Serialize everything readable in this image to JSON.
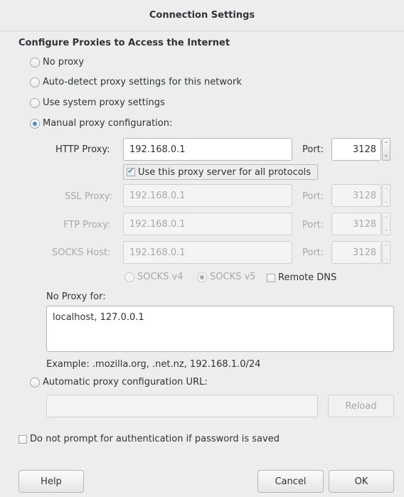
{
  "window": {
    "title": "Connection Settings"
  },
  "section_heading": "Configure Proxies to Access the Internet",
  "proxy_modes": [
    {
      "label": "No proxy",
      "selected": false
    },
    {
      "label": "Auto-detect proxy settings for this network",
      "selected": false
    },
    {
      "label": "Use system proxy settings",
      "selected": false
    },
    {
      "label": "Manual proxy configuration:",
      "selected": true
    }
  ],
  "http": {
    "label": "HTTP Proxy:",
    "value": "192.168.0.1",
    "port_label": "Port:",
    "port": "3128"
  },
  "share_all": {
    "label": "Use this proxy server for all protocols",
    "checked": true
  },
  "ssl": {
    "label": "SSL Proxy:",
    "value": "192.168.0.1",
    "port_label": "Port:",
    "port": "3128"
  },
  "ftp": {
    "label": "FTP Proxy:",
    "value": "192.168.0.1",
    "port_label": "Port:",
    "port": "3128"
  },
  "socks": {
    "label": "SOCKS Host:",
    "value": "192.168.0.1",
    "port_label": "Port:",
    "port": "3128"
  },
  "socks_versions": [
    {
      "label": "SOCKS v4",
      "selected": false
    },
    {
      "label": "SOCKS v5",
      "selected": true
    }
  ],
  "remote_dns": {
    "label": "Remote DNS",
    "checked": false
  },
  "no_proxy": {
    "label": "No Proxy for:",
    "value": "localhost, 127.0.0.1",
    "example": "Example: .mozilla.org, .net.nz, 192.168.1.0/24"
  },
  "auto_config": {
    "label": "Automatic proxy configuration URL:",
    "selected": false,
    "value": "",
    "reload_label": "Reload"
  },
  "auth_prompt": {
    "label": "Do not prompt for authentication if password is saved",
    "checked": false
  },
  "buttons": {
    "help": "Help",
    "cancel": "Cancel",
    "ok": "OK"
  },
  "colors": {
    "accent": "#4a90d9",
    "background": "#ededed"
  }
}
